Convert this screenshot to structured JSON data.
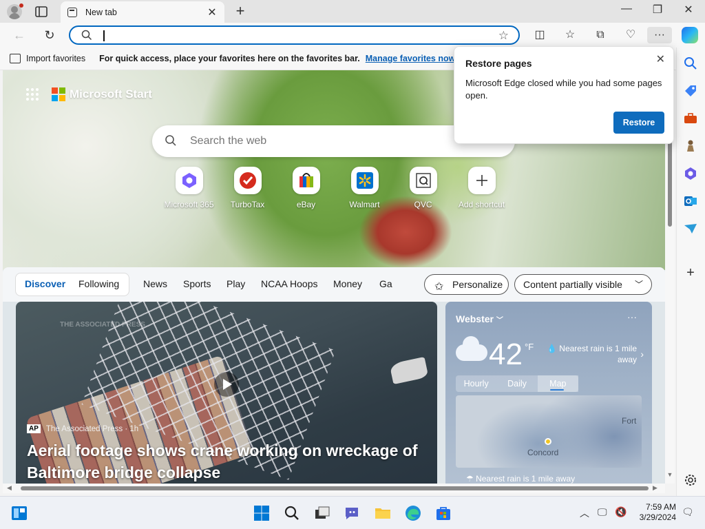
{
  "browser": {
    "tab_title": "New tab",
    "tab_close": "✕",
    "new_tab": "+",
    "window_controls": {
      "minimize": "—",
      "restore": "❐",
      "close": "✕"
    }
  },
  "addressbar": {
    "value": "",
    "placeholder": "",
    "back": "←",
    "refresh": "↻",
    "star": "☆"
  },
  "toolbar": {
    "split": "◫",
    "favorites": "☆",
    "collections": "⧉",
    "performance": "♡",
    "more": "···"
  },
  "favbar": {
    "import_label": "Import favorites",
    "message": "For quick access, place your favorites here on the favorites bar.",
    "manage_link": "Manage favorites now"
  },
  "popup": {
    "title": "Restore pages",
    "body": "Microsoft Edge closed while you had some pages open.",
    "button": "Restore",
    "close": "✕"
  },
  "newtab": {
    "brand": "Microsoft Start",
    "search_placeholder": "Search the web",
    "shortcuts": [
      {
        "label": "Microsoft 365",
        "icon": "microsoft-365-icon"
      },
      {
        "label": "TurboTax",
        "icon": "turbotax-icon"
      },
      {
        "label": "eBay",
        "icon": "ebay-icon"
      },
      {
        "label": "Walmart",
        "icon": "walmart-icon"
      },
      {
        "label": "QVC",
        "icon": "qvc-icon"
      },
      {
        "label": "Add shortcut",
        "icon": "plus-icon"
      }
    ]
  },
  "feed": {
    "tabs": [
      "Discover",
      "Following",
      "News",
      "Sports",
      "Play",
      "NCAA Hoops",
      "Money",
      "Ga"
    ],
    "active_tab": "Discover",
    "personalize": "Personalize",
    "visibility": "Content partially visible"
  },
  "news": {
    "watermark": "THE ASSOCIATED PRESS",
    "source_logo": "AP",
    "source": "The Associated Press · 1h",
    "headline": "Aerial footage shows crane working on wreckage of Baltimore bridge collapse"
  },
  "weather": {
    "location": "Webster",
    "more": "···",
    "temp": "42",
    "unit": "°F",
    "rain": "Nearest rain is 1 mile away",
    "tabs": [
      "Hourly",
      "Daily",
      "Map"
    ],
    "active_tab": "Map",
    "map_labels": {
      "city": "Concord",
      "fort": "Fort"
    },
    "footer": "Nearest rain is 1 mile away"
  },
  "taskbar": {
    "time": "7:59 AM",
    "date": "3/29/2024"
  },
  "colors": {
    "accent": "#0067c0",
    "restore_button": "#0f6cbd",
    "link": "#0a5fb4"
  }
}
